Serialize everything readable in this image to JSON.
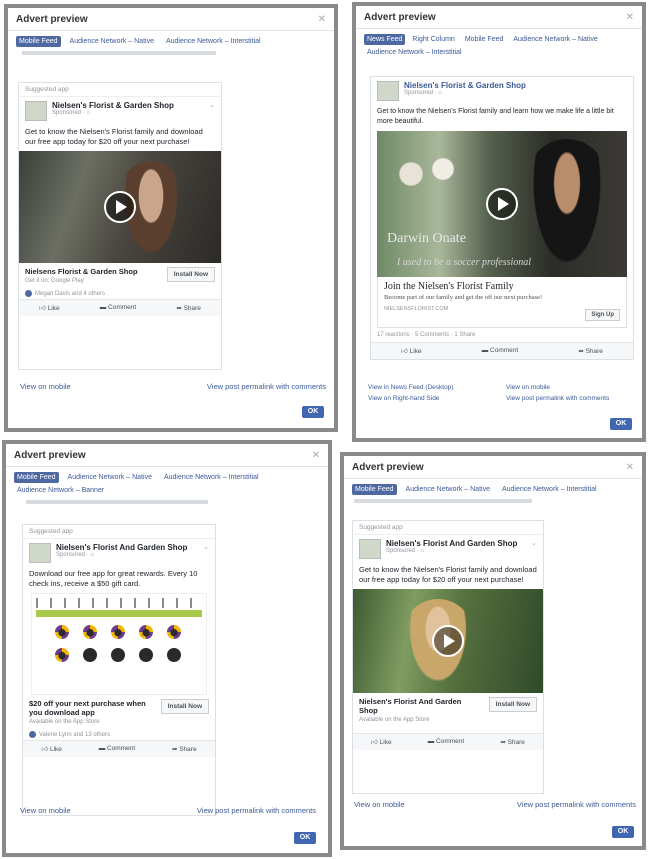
{
  "panel1": {
    "title": "Advert preview",
    "tabs": [
      "Mobile Feed",
      "Audience Network – Native",
      "Audience Network – Interstitial"
    ],
    "suggested": "Suggested app",
    "page_name": "Nielsen's Florist & Garden Shop",
    "sponsored": "Sponsored · ⌂",
    "body": "Get to know the Nielsen's Florist family and download our free app today for $20 off your next purchase!",
    "cta_title": "Nielsens Florist & Garden Shop",
    "cta_sub": "Get it on: Google Play",
    "install": "Install Now",
    "social": "Megan Davis and 4 others",
    "actions": [
      "Like",
      "Comment",
      "Share"
    ],
    "link_left": "View on mobile",
    "link_right": "View post permalink with comments",
    "ok": "OK"
  },
  "panel2": {
    "title": "Advert preview",
    "tabs": [
      "News Feed",
      "Right Column",
      "Mobile Feed",
      "Audience Network – Native",
      "Audience Network – Interstitial"
    ],
    "page_name": "Nielsen's Florist & Garden Shop",
    "sponsored": "Sponsored · ⌂",
    "body": "Get to know the Nielsen's Florist family and learn how we make life a little bit more beautiful.",
    "overlay_name": "Darwin Onate",
    "overlay_quote": "I used to be a soccer professional",
    "link_title": "Join the Nielsen's Florist Family",
    "link_desc": "Become part of our family and get the off our next purchase!",
    "link_url": "NIELSENSFLORIST.COM",
    "signup": "Sign Up",
    "stats": "17 reactions · 5 Comments · 1 Share",
    "actions": [
      "Like",
      "Comment",
      "Share"
    ],
    "links_left": [
      "View in News Feed (Desktop)",
      "View on Right-hand Side"
    ],
    "links_right": [
      "View on mobile",
      "View post permalink with comments"
    ],
    "ok": "OK"
  },
  "panel3": {
    "title": "Advert preview",
    "tabs": [
      "Mobile Feed",
      "Audience Network – Native",
      "Audience Network – Interstitial",
      "Audience Network – Banner"
    ],
    "suggested": "Suggested app",
    "page_name": "Nielsen's Florist And Garden Shop",
    "sponsored": "Sponsored · ⌂",
    "body": "Download our free app for great rewards. Every 10 check ins, receive a $50 gift card.",
    "cta_title": "$20 off your next purchase when you download app",
    "cta_sub": "Available on the App Store",
    "install": "Install Now",
    "social": "Valerie Lynn and 13 others",
    "actions": [
      "Like",
      "Comment",
      "Share"
    ],
    "link_left": "View on mobile",
    "link_right": "View post permalink with comments",
    "ok": "OK"
  },
  "panel4": {
    "title": "Advert preview",
    "tabs": [
      "Mobile Feed",
      "Audience Network – Native",
      "Audience Network – Interstitial"
    ],
    "suggested": "Suggested app",
    "page_name": "Nielsen's Florist And Garden Shop",
    "sponsored": "Sponsored · ⌂",
    "body": "Get to know the Nielsen's Florist family and download our free app today for $20 off your next purchase!",
    "cta_title": "Nielsen's Florist And Garden Shop",
    "cta_sub": "Available on the App Store",
    "install": "Install Now",
    "actions": [
      "Like",
      "Comment",
      "Share"
    ],
    "link_left": "View on mobile",
    "link_right": "View post permalink with comments",
    "ok": "OK"
  }
}
